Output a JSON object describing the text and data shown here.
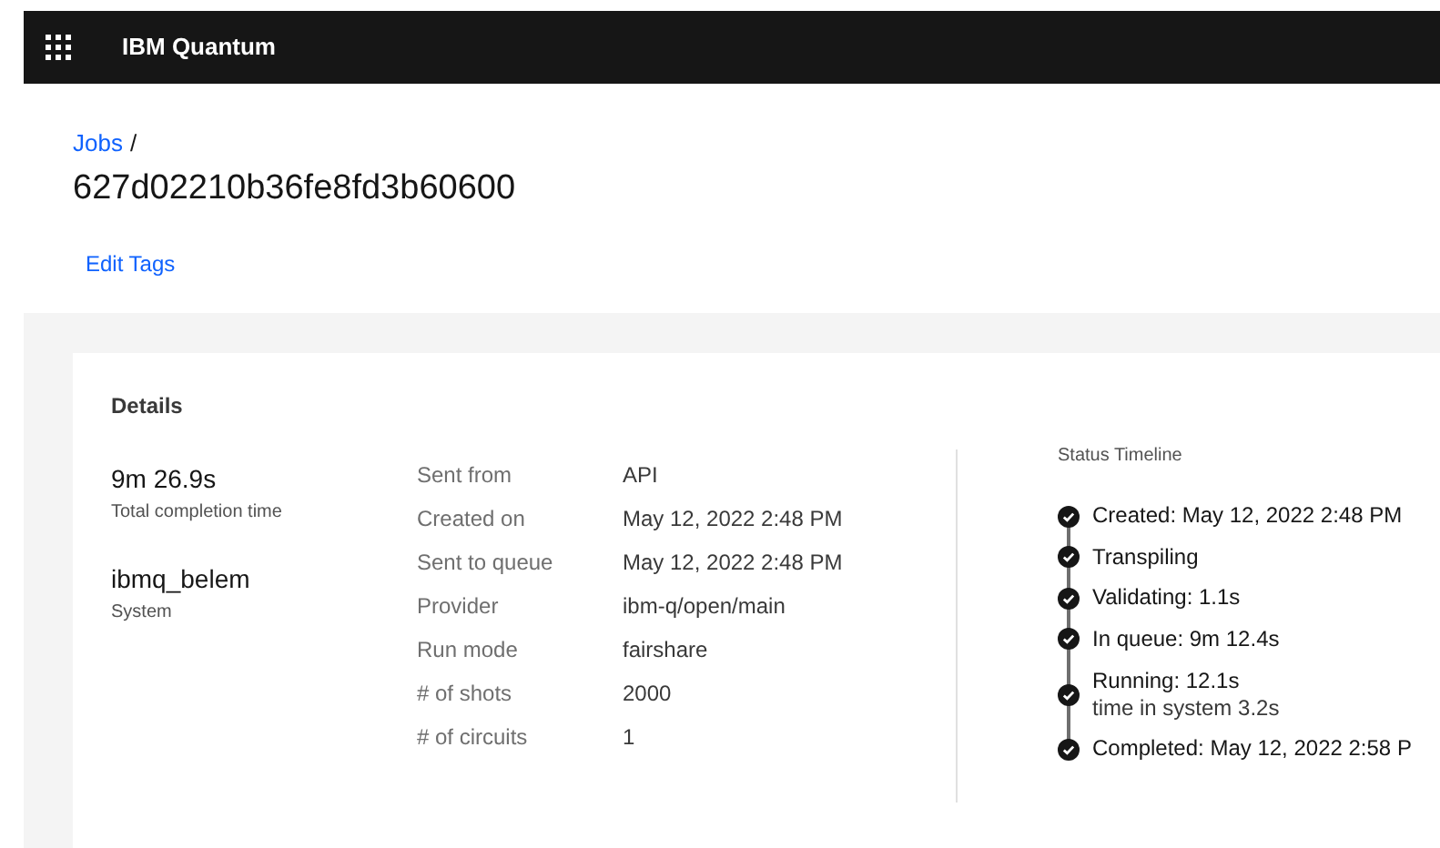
{
  "header": {
    "title": "IBM Quantum"
  },
  "breadcrumb": {
    "link": "Jobs",
    "separator": "/"
  },
  "job_id": "627d02210b36fe8fd3b60600",
  "edit_tags": "Edit Tags",
  "details": {
    "title": "Details",
    "summary": [
      {
        "value": "9m 26.9s",
        "label": "Total completion time"
      },
      {
        "value": "ibmq_belem",
        "label": "System"
      }
    ],
    "fields": [
      {
        "label": "Sent from",
        "value": "API"
      },
      {
        "label": "Created on",
        "value": "May 12, 2022 2:48 PM"
      },
      {
        "label": "Sent to queue",
        "value": "May 12, 2022 2:48 PM"
      },
      {
        "label": "Provider",
        "value": "ibm-q/open/main"
      },
      {
        "label": "Run mode",
        "value": "fairshare"
      },
      {
        "label": "# of shots",
        "value": "2000"
      },
      {
        "label": "# of circuits",
        "value": "1"
      }
    ]
  },
  "status_timeline": {
    "title": "Status Timeline",
    "steps": [
      {
        "text": "Created: May 12, 2022 2:48 PM",
        "completed": true
      },
      {
        "text": "Transpiling",
        "completed": true
      },
      {
        "text": "Validating: 1.1s",
        "completed": true
      },
      {
        "text": "In queue: 9m 12.4s",
        "completed": true
      },
      {
        "text": "Running: 12.1s",
        "note": "time in system 3.2s",
        "completed": true
      },
      {
        "text": "Completed: May 12, 2022 2:58 P",
        "completed": true
      }
    ]
  }
}
